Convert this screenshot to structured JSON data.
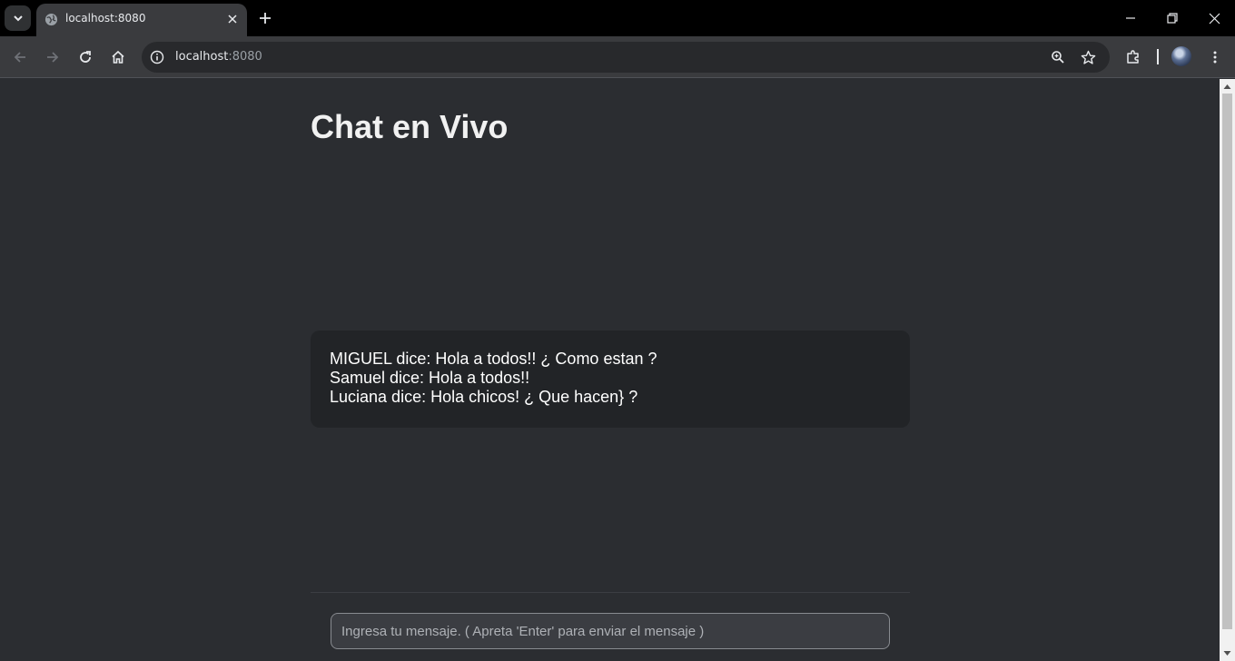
{
  "browser": {
    "tab_title": "localhost:8080",
    "url_host": "localhost",
    "url_port": ":8080"
  },
  "page": {
    "title": "Chat en Vivo",
    "messages": [
      "MIGUEL dice: Hola a todos!! ¿ Como estan ?",
      "Samuel dice: Hola a todos!!",
      "Luciana dice: Hola chicos! ¿ Que hacen} ?"
    ],
    "input_placeholder": "Ingresa tu mensaje. ( Apreta 'Enter' para enviar el mensaje )",
    "input_value": ""
  },
  "colors": {
    "page_bg": "#2b2d31",
    "chat_box_bg": "#222427",
    "title_text": "#f1f1f1",
    "message_text": "#ffffff"
  }
}
